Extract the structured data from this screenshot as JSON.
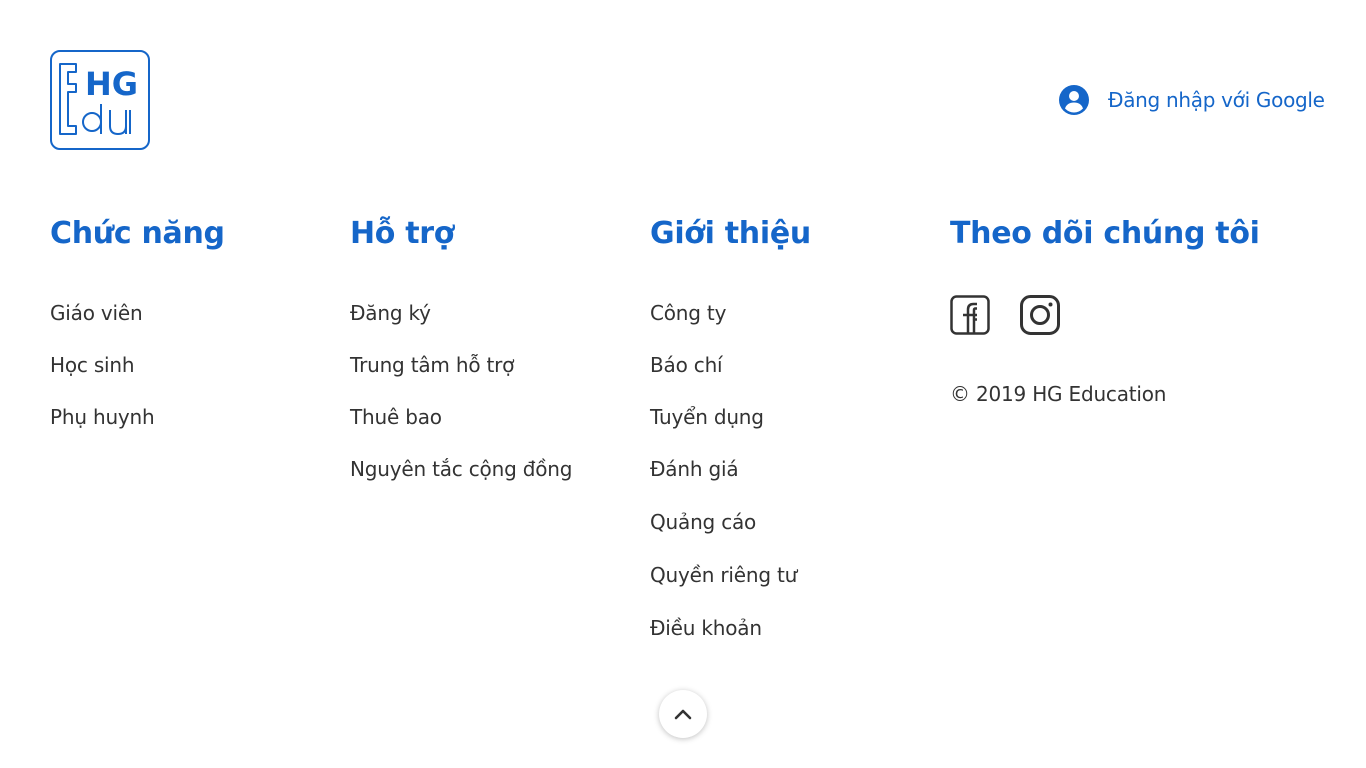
{
  "brand": {
    "logo_line1": "HG",
    "logo_line2": "Edu",
    "accent_color": "#1566c9",
    "text_color": "#333333"
  },
  "header": {
    "login_icon": "user-circle-icon",
    "login_label": "Đăng nhập với Google"
  },
  "footer": {
    "columns": [
      {
        "title": "Chức năng",
        "links": [
          "Giáo viên",
          "Học sinh",
          "Phụ huynh"
        ]
      },
      {
        "title": "Hỗ trợ",
        "links": [
          "Đăng ký",
          "Trung tâm hỗ trợ",
          "Thuê bao",
          "Nguyên tắc cộng đồng"
        ]
      },
      {
        "title": "Giới thiệu",
        "links": [
          "Công ty",
          "Báo chí",
          "Tuyển dụng",
          "Đánh giá",
          "Quảng cáo",
          "Quyền riêng tư",
          "Điều khoản"
        ]
      }
    ],
    "follow": {
      "title": "Theo dõi chúng tôi",
      "icons": [
        "facebook-icon",
        "instagram-icon"
      ],
      "copyright": "© 2019 HG Education"
    },
    "back_to_top_icon": "chevron-up-icon"
  }
}
